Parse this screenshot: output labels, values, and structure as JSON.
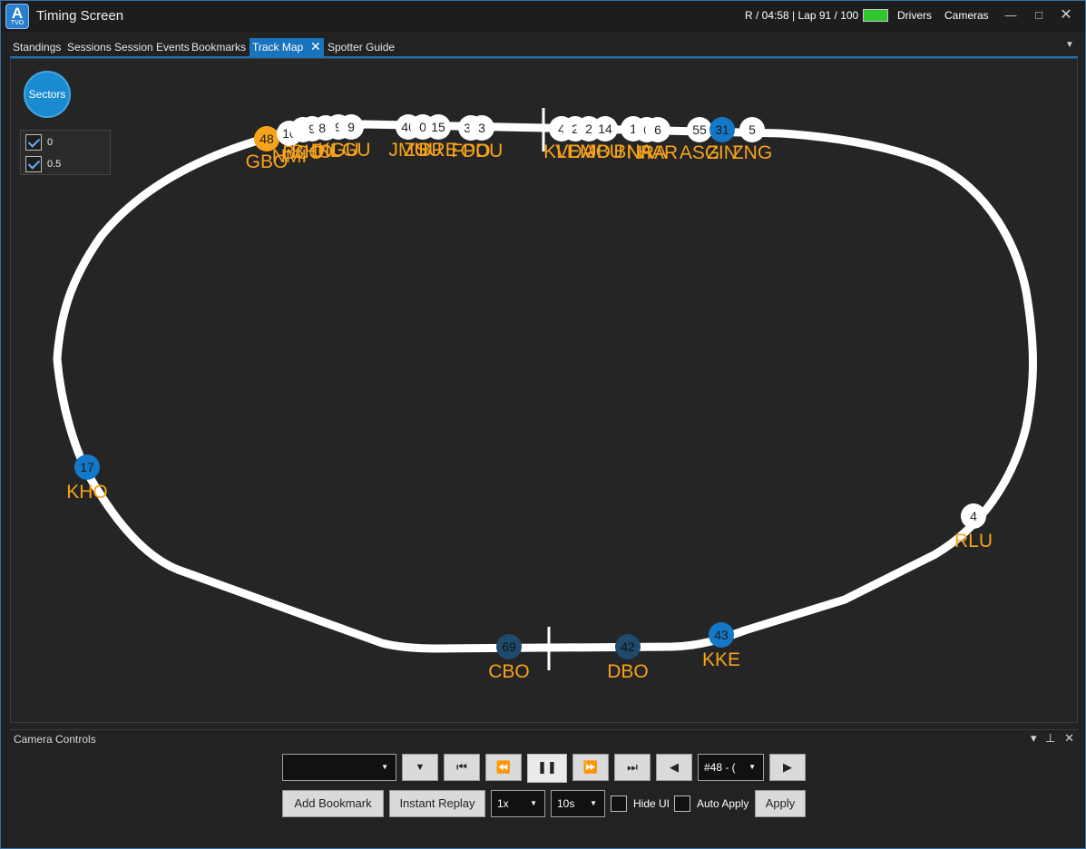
{
  "app": {
    "logo_letter": "A",
    "logo_sub": "TVO",
    "title": "Timing Screen",
    "status": "R / 04:58 | Lap 91 / 100",
    "drivers_label": "Drivers",
    "cameras_label": "Cameras"
  },
  "tabs": [
    {
      "label": "Standings"
    },
    {
      "label": "Sessions"
    },
    {
      "label": "Session Events"
    },
    {
      "label": "Bookmarks"
    },
    {
      "label": "Track Map",
      "active": true
    },
    {
      "label": "Spotter Guide"
    }
  ],
  "map": {
    "sectors_button": "Sectors",
    "sectors": [
      {
        "label": "0",
        "checked": true
      },
      {
        "label": "0.5",
        "checked": true
      }
    ],
    "colors": {
      "track": "#ffffff",
      "label": "#f7a21b",
      "car_white": "#ffffff",
      "car_orange": "#f7a21b",
      "car_blue": "#1478c8",
      "car_navy": "#1f4a6b"
    },
    "cars": [
      {
        "number": "48",
        "code": "GBO",
        "style": "orange"
      },
      {
        "number": "10",
        "code": "NMI",
        "style": "white"
      },
      {
        "number": "7",
        "code": "BCO",
        "style": "white"
      },
      {
        "number": "9",
        "code": "BHO",
        "style": "white"
      },
      {
        "number": "88",
        "code": "DIL",
        "style": "white"
      },
      {
        "number": "9",
        "code": "KGU",
        "style": "white"
      },
      {
        "number": "9",
        "code": "LGU",
        "style": "white"
      },
      {
        "number": "46",
        "code": "JMU",
        "style": "white"
      },
      {
        "number": "0",
        "code": "ZSU",
        "style": "white"
      },
      {
        "number": "15",
        "code": "BRE",
        "style": "white"
      },
      {
        "number": "33",
        "code": "FPO",
        "style": "white"
      },
      {
        "number": "3",
        "code": "ODU",
        "style": "white"
      },
      {
        "number": "4",
        "code": "KLE",
        "style": "white"
      },
      {
        "number": "2",
        "code": "VDA",
        "style": "white"
      },
      {
        "number": "2",
        "code": "EMO",
        "style": "white"
      },
      {
        "number": "14",
        "code": "JBU",
        "style": "white"
      },
      {
        "number": "1",
        "code": "BNA",
        "style": "white"
      },
      {
        "number": "6",
        "code": "NRA",
        "style": "white"
      },
      {
        "number": "6",
        "code": "HAR",
        "style": "white"
      },
      {
        "number": "55",
        "code": "ASG",
        "style": "white"
      },
      {
        "number": "31",
        "code": "ZIN",
        "style": "blue"
      },
      {
        "number": "5",
        "code": "ZNG",
        "style": "white"
      },
      {
        "number": "17",
        "code": "KHO",
        "style": "blue"
      },
      {
        "number": "4",
        "code": "RLU",
        "style": "white"
      },
      {
        "number": "43",
        "code": "KKE",
        "style": "blue"
      },
      {
        "number": "42",
        "code": "DBO",
        "style": "navy"
      },
      {
        "number": "69",
        "code": "CBO",
        "style": "navy"
      }
    ]
  },
  "camera_controls": {
    "title": "Camera Controls",
    "camera_select": "",
    "driver_select": "#48 - (",
    "add_bookmark": "Add Bookmark",
    "instant_replay": "Instant Replay",
    "speed": "1x",
    "duration": "10s",
    "hide_ui": "Hide UI",
    "auto_apply": "Auto Apply",
    "apply": "Apply"
  }
}
